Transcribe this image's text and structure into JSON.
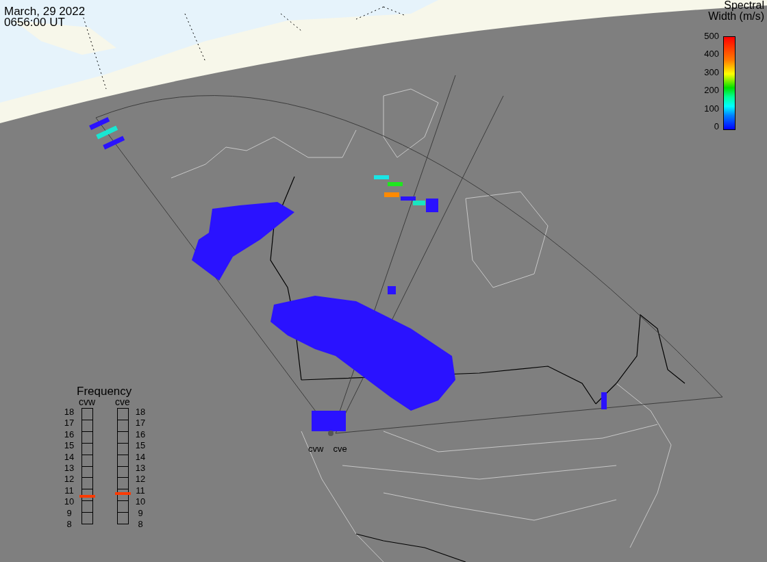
{
  "timestamp": {
    "date": "March, 29 2022",
    "time": "0656:00 UT"
  },
  "colorbar": {
    "title_lines": [
      "Spectral",
      "Width (m/s)"
    ],
    "ticks": [
      "500",
      "400",
      "300",
      "200",
      "100",
      "0"
    ]
  },
  "frequency": {
    "title": "Frequency",
    "radars": [
      {
        "name": "cvw",
        "level": 0.24,
        "ticks": [
          "18",
          "17",
          "16",
          "15",
          "14",
          "13",
          "12",
          "11",
          "10",
          "9",
          "8"
        ]
      },
      {
        "name": "cve",
        "level": 0.26,
        "ticks": [
          "18",
          "17",
          "16",
          "15",
          "14",
          "13",
          "12",
          "11",
          "10",
          "9",
          "8"
        ]
      }
    ]
  },
  "site_labels": [
    "cvw",
    "cve"
  ]
}
